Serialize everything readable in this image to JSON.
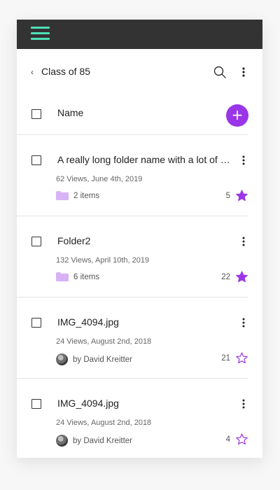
{
  "header": {
    "menu_icon": "hamburger-icon",
    "accent_color": "#4fe0b7",
    "bar_color": "#333333"
  },
  "subheader": {
    "back_glyph": "‹",
    "title": "Class of 85",
    "search_icon": "search-icon",
    "more_icon": "more-vertical-icon"
  },
  "list_header": {
    "name_label": "Name",
    "add_glyph": "+",
    "add_color": "#9b35e8"
  },
  "items": [
    {
      "title": "A really long folder name with a lot of words",
      "meta": "62 Views, June 4th, 2019",
      "kind": "folder",
      "sub": "2 items",
      "count": "5",
      "starred": true
    },
    {
      "title": "Folder2",
      "meta": "132 Views, April 10th, 2019",
      "kind": "folder",
      "sub": "6 items",
      "count": "22",
      "starred": true
    },
    {
      "title": "IMG_4094.jpg",
      "meta": "24 Views, August 2nd, 2018",
      "kind": "image",
      "sub": "by David Kreitter",
      "count": "21",
      "starred": false
    },
    {
      "title": "IMG_4094.jpg",
      "meta": "24 Views, August 2nd, 2018",
      "kind": "image",
      "sub": "by David Kreitter",
      "count": "4",
      "starred": false
    }
  ],
  "colors": {
    "star": "#9b35e8",
    "folder": "#d7b3f5"
  }
}
